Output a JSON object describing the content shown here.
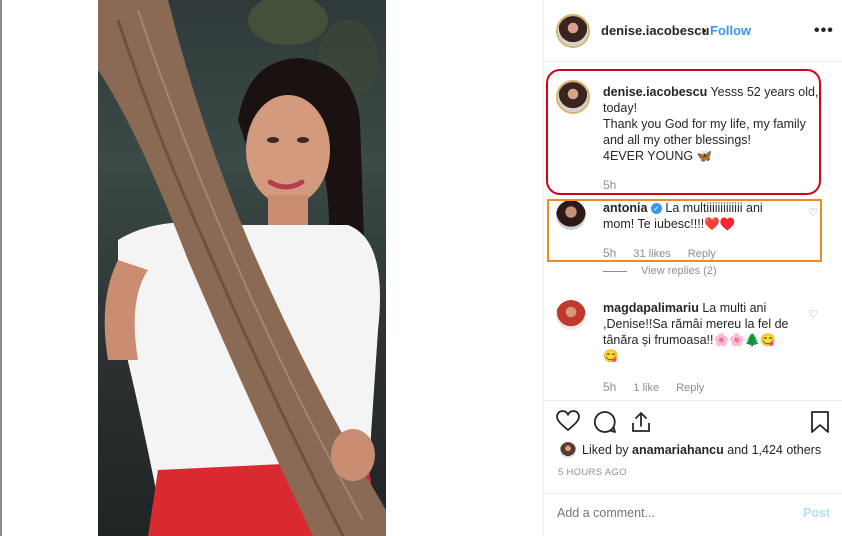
{
  "header": {
    "username": "denise.iacobescu",
    "separator": "•",
    "follow_label": "Follow",
    "more_icon": "more-options-icon"
  },
  "caption": {
    "username": "denise.iacobescu",
    "lines": [
      "Yesss 52 years old,",
      "today!",
      "Thank you God for my life, my family",
      "and all my other blessings!",
      "4EVER YOUNG 🦋"
    ],
    "time": "5h"
  },
  "comments": [
    {
      "username": "antonia",
      "verified": true,
      "text_lines": [
        "La multiiiiiiiiiiiii ani",
        "mom! Te iubesc!!!!❤️♥️"
      ],
      "time": "5h",
      "likes": "31 likes",
      "reply_label": "Reply",
      "view_replies": "View replies (2)"
    },
    {
      "username": "magdapalimariu",
      "text_lines": [
        "La multi ani",
        ",Denise!!Sa rămâi mereu la fel de",
        "tânăra și frumoasa!!🌸🌸🌲😋",
        "😋"
      ],
      "time": "5h",
      "likes": "1 like",
      "reply_label": "Reply"
    }
  ],
  "actions": {
    "liked_by_prefix": "Liked by",
    "liked_by_user": "anamariahancu",
    "liked_by_suffix": "and 1,424 others",
    "time_ago": "5 HOURS AGO"
  },
  "add_comment": {
    "placeholder": "Add a comment...",
    "post_label": "Post"
  },
  "colors": {
    "accent": "#3897f0",
    "caption_highlight": "#d0021b",
    "comment_highlight": "#f08a24"
  }
}
